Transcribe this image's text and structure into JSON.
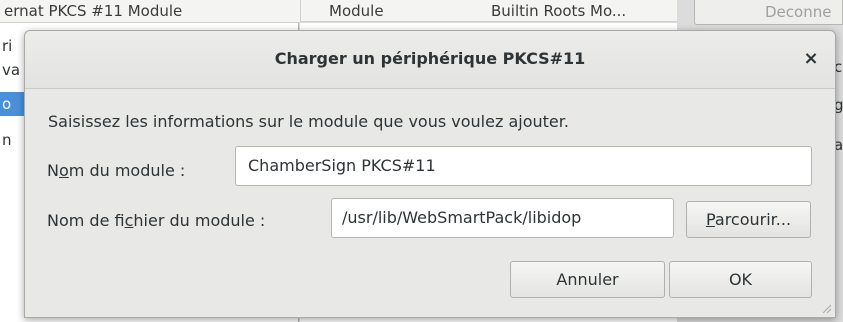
{
  "background": {
    "left_header": "ernat PKCS #11 Module",
    "right_header_col1": "Module",
    "right_header_col2": "Builtin Roots Mo...",
    "top_right_button": "Deconne",
    "left_rows": [
      {
        "text": "ri",
        "selected": false
      },
      {
        "text": "va",
        "selected": false
      },
      {
        "text": "o",
        "selected": true
      },
      {
        "text": "n",
        "selected": false
      }
    ],
    "right_edge_rows": [
      "c",
      "g",
      "ar"
    ]
  },
  "dialog": {
    "title": "Charger un périphérique PKCS#11",
    "close_glyph": "×",
    "description": "Saisissez les informations sur le module que vous voulez ajouter.",
    "module_name": {
      "label_pre": "N",
      "label_mnemonic": "o",
      "label_post": "m du module :",
      "value": "ChamberSign PKCS#11"
    },
    "module_file": {
      "label_pre": "Nom de fi",
      "label_mnemonic": "c",
      "label_post": "hier du module :",
      "value": "/usr/lib/WebSmartPack/libidop"
    },
    "browse_button": {
      "mnemonic": "P",
      "rest": "arcourir..."
    },
    "cancel_button": "Annuler",
    "ok_button": "OK"
  },
  "colors": {
    "selection": "#4a90d9",
    "dialog_bg": "#e8e8e7",
    "text": "#2e3436"
  }
}
